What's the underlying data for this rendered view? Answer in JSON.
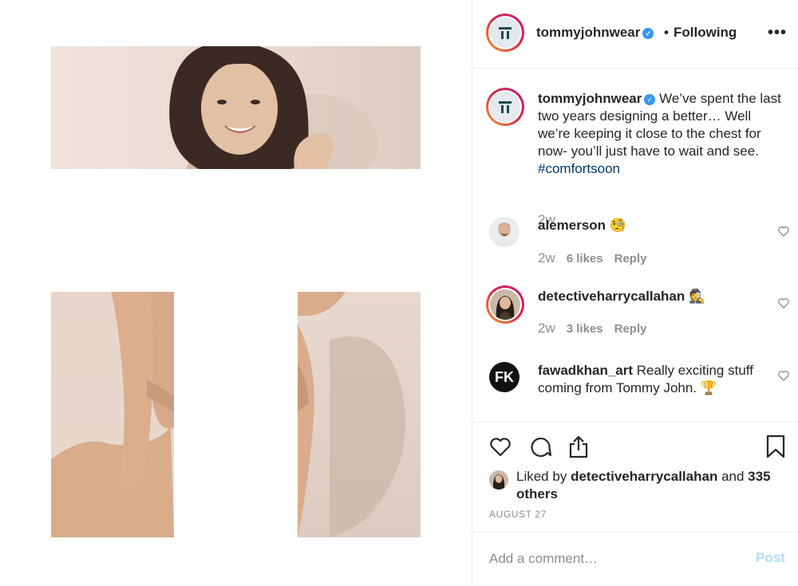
{
  "post": {
    "author": "tommyjohnwear",
    "follow_separator": "•",
    "follow_status": "Following",
    "more_label": "•••",
    "verified_glyph": "✓",
    "caption": "We’ve spent the last two years designing a better… Well we’re keeping it close to the chest for now- you’ll just have to wait and see.",
    "hashtag": "#comfortsoon",
    "caption_time": "2w"
  },
  "comments": [
    {
      "user": "alemerson",
      "text": "🧐",
      "time": "2w",
      "likes": "6 likes",
      "reply": "Reply"
    },
    {
      "user": "detectiveharrycallahan",
      "text": "🕵",
      "time": "2w",
      "likes": "3 likes",
      "reply": "Reply"
    },
    {
      "user": "fawadkhan_art",
      "text": "Really exciting stuff coming from Tommy John. 🏆",
      "avatar_initials": "FK"
    }
  ],
  "actions": {
    "liked_by_prefix": "Liked by",
    "liked_by_user": "detectiveharrycallahan",
    "liked_by_and": "and",
    "liked_by_others": "335 others",
    "date": "AUGUST 27"
  },
  "add_comment": {
    "placeholder": "Add a comment…",
    "post_label": "Post"
  },
  "colors": {
    "accent_blue": "#3897f0",
    "hashtag": "#00376b",
    "post_disabled": "#b3dbff",
    "muted": "#8e8e8e"
  },
  "icons": [
    "verified-icon",
    "more-icon",
    "heart-icon",
    "comment-icon",
    "share-icon",
    "bookmark-icon"
  ]
}
